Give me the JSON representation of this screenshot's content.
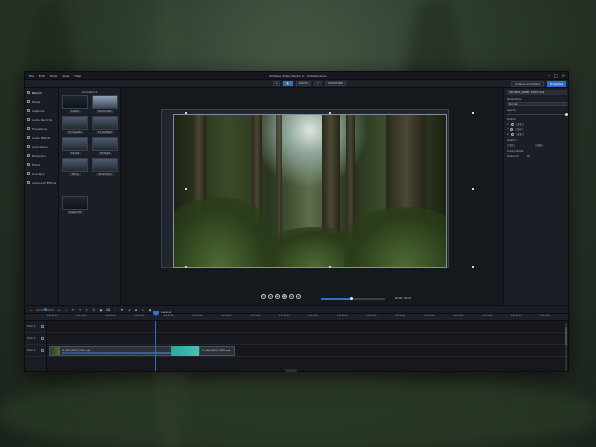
{
  "menu": [
    "File",
    "Edit",
    "Tools",
    "View",
    "Help"
  ],
  "app_title": "ACDSee Video Studio 4 - Untitled.avvs",
  "window_controls": [
    "minimize-icon",
    "maximize-icon",
    "close-icon"
  ],
  "toolbar": {
    "zoom": "100.0%",
    "resolution": "1920x1080",
    "produce_label": "Produce and Share",
    "properties_label": "Properties"
  },
  "sidebar": {
    "items": [
      {
        "label": "Record",
        "icon": "record-icon"
      },
      {
        "label": "Media",
        "icon": "media-icon"
      },
      {
        "label": "Captions",
        "icon": "captions-icon"
      },
      {
        "label": "Audio Records",
        "icon": "mic-icon"
      },
      {
        "label": "Transitions",
        "icon": "transitions-icon"
      },
      {
        "label": "Audio Effects",
        "icon": "audio-effects-icon"
      },
      {
        "label": "Animations",
        "icon": "animations-icon"
      },
      {
        "label": "Behaviors",
        "icon": "behaviors-icon"
      },
      {
        "label": "Filters",
        "icon": "filters-icon"
      },
      {
        "label": "Overlays",
        "icon": "overlays-icon"
      },
      {
        "label": "Advanced Effects",
        "icon": "advanced-effects-icon"
      }
    ]
  },
  "library": {
    "title": "Animations",
    "items": [
      {
        "label": "Custom",
        "style": "dark"
      },
      {
        "label": "Zoom-n-Pan",
        "style": "light"
      },
      {
        "label": "Fly Vignette",
        "style": "mid"
      },
      {
        "label": "Fly Spotlight",
        "style": "mid"
      },
      {
        "label": "Tilt Left",
        "style": "mid"
      },
      {
        "label": "Tilt Right",
        "style": "mid"
      },
      {
        "label": "Tilt Up",
        "style": "mid"
      },
      {
        "label": "Spiral Down",
        "style": "mid"
      },
      {
        "label": "Scale to Fit",
        "style": "dark"
      }
    ]
  },
  "preview": {
    "timecode": "00:00 / 00:41"
  },
  "properties": {
    "clip_name": "VID-9B63_AGENT_STATS.mp4",
    "name_label": "Media Name",
    "name_value": "Box Lab",
    "opacity_label": "Opacity",
    "position_label": "Position",
    "pos_rows": [
      {
        "axis": "X",
        "value": "0.0"
      },
      {
        "axis": "Y",
        "value": "0.0"
      },
      {
        "axis": "Z",
        "value": "0.0"
      }
    ],
    "rotation_label": "Rotation",
    "rotation_value": "0.0",
    "scale_value": "100",
    "scaling_label": "Scaling Modes",
    "scaling_left": "Scale to fit",
    "scaling_right": "Fill"
  },
  "timeline": {
    "ticks": [
      "0:00:00:00",
      "0:00:10:00",
      "0:00:20:00",
      "0:00:30:00",
      "0:00:40:00",
      "0:00:50:00",
      "0:01:00:00",
      "0:01:10:00",
      "0:01:20:00",
      "0:01:30:00",
      "0:01:40:00",
      "0:01:50:00",
      "0:02:00:00",
      "0:02:10:00",
      "0:02:20:00",
      "0:02:30:00",
      "0:02:40:00",
      "0:02:50:00"
    ],
    "tracks": [
      "Track 3",
      "Track 2",
      "Track 1"
    ],
    "clip1_name": "01_NEW_AGENT_STATS.mp4",
    "clip2_name": "01_NEW_AGENT_STATS.mp4",
    "playhead_label": "0:00:01:03"
  }
}
